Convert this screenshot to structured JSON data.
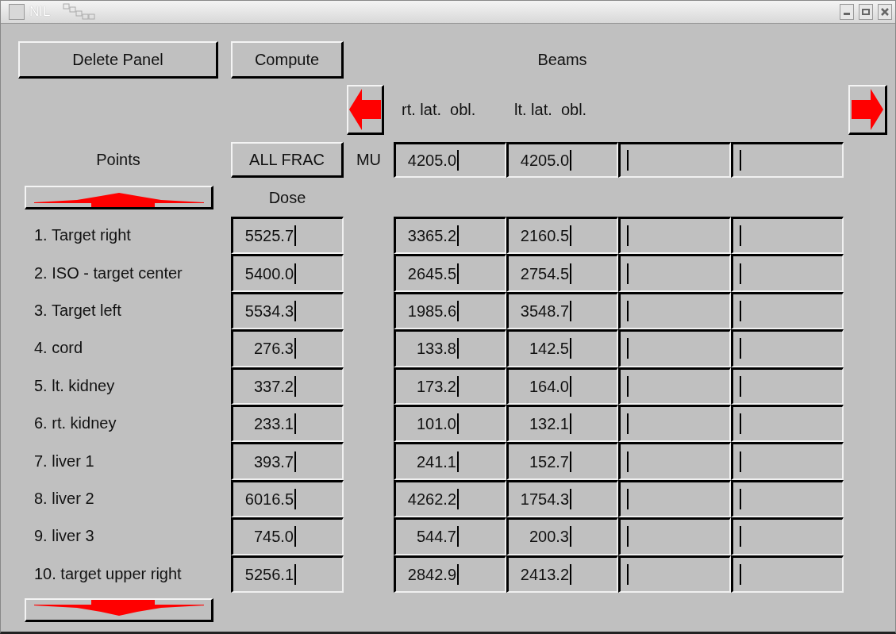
{
  "window": {
    "title": "NIL"
  },
  "buttons": {
    "delete_panel": "Delete Panel",
    "compute": "Compute",
    "all_frac": "ALL FRAC"
  },
  "beams_label": "Beams",
  "points_label": "Points",
  "dose_label": "Dose",
  "mu_label": "MU",
  "beam_columns": [
    {
      "name": "rt. lat.  obl.",
      "mu": "4205.0"
    },
    {
      "name": "lt. lat.  obl.",
      "mu": "4205.0"
    },
    {},
    {}
  ],
  "points": [
    {
      "label": "1. Target right",
      "dose": "5525.7",
      "beam_doses": [
        "3365.2",
        "2160.5"
      ]
    },
    {
      "label": "2. ISO - target center",
      "dose": "5400.0",
      "beam_doses": [
        "2645.5",
        "2754.5"
      ]
    },
    {
      "label": "3. Target left",
      "dose": "5534.3",
      "beam_doses": [
        "1985.6",
        "3548.7"
      ]
    },
    {
      "label": "4. cord",
      "dose": "276.3",
      "beam_doses": [
        "133.8",
        "142.5"
      ]
    },
    {
      "label": "5. lt. kidney",
      "dose": "337.2",
      "beam_doses": [
        "173.2",
        "164.0"
      ]
    },
    {
      "label": "6. rt. kidney",
      "dose": "233.1",
      "beam_doses": [
        "101.0",
        "132.1"
      ]
    },
    {
      "label": "7. liver 1",
      "dose": "393.7",
      "beam_doses": [
        "241.1",
        "152.7"
      ]
    },
    {
      "label": "8. liver 2",
      "dose": "6016.5",
      "beam_doses": [
        "4262.2",
        "1754.3"
      ]
    },
    {
      "label": "9. liver 3",
      "dose": "745.0",
      "beam_doses": [
        "544.7",
        "200.3"
      ]
    },
    {
      "label": "10. target upper right",
      "dose": "5256.1",
      "beam_doses": [
        "2842.9",
        "2413.2"
      ]
    }
  ]
}
